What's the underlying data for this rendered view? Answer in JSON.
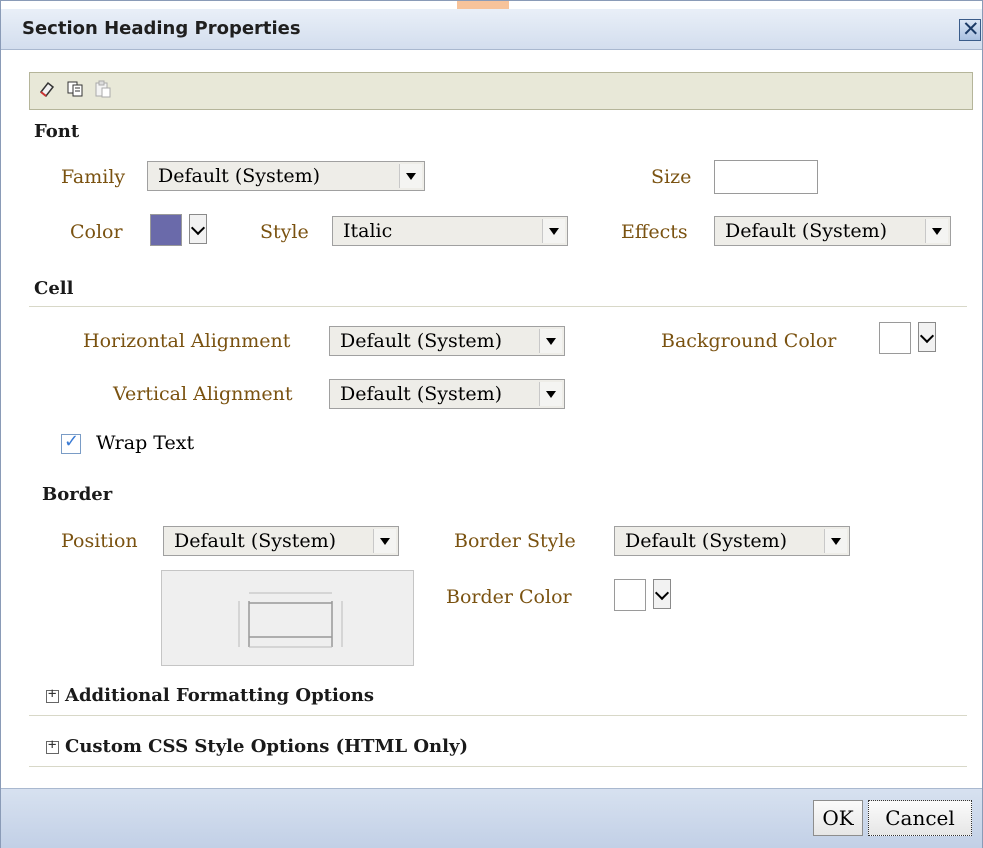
{
  "dialog": {
    "title": "Section Heading Properties"
  },
  "toolbar": {
    "icons": [
      "eraser-icon",
      "copy-icon",
      "paste-icon"
    ]
  },
  "font": {
    "heading": "Font",
    "family_label": "Family",
    "family_value": "Default (System)",
    "size_label": "Size",
    "size_value": "",
    "color_label": "Color",
    "color_value": "#6a6aaa",
    "style_label": "Style",
    "style_value": "Italic",
    "effects_label": "Effects",
    "effects_value": "Default (System)"
  },
  "cell": {
    "heading": "Cell",
    "halign_label": "Horizontal Alignment",
    "halign_value": "Default (System)",
    "bgcolor_label": "Background Color",
    "bgcolor_value": "#ffffff",
    "valign_label": "Vertical Alignment",
    "valign_value": "Default (System)",
    "wrap_label": "Wrap Text",
    "wrap_checked": true
  },
  "border": {
    "heading": "Border",
    "position_label": "Position",
    "position_value": "Default (System)",
    "style_label": "Border Style",
    "style_value": "Default (System)",
    "color_label": "Border Color",
    "color_value": "#ffffff"
  },
  "collapsibles": {
    "additional": "Additional Formatting Options",
    "custom_css": "Custom CSS Style Options (HTML Only)"
  },
  "footer": {
    "ok_label": "OK",
    "cancel_label": "Cancel"
  },
  "colors": {
    "label_text": "#7a5210",
    "title_bar": "#d3deee",
    "toolbar_bg": "#e8e8d8"
  }
}
